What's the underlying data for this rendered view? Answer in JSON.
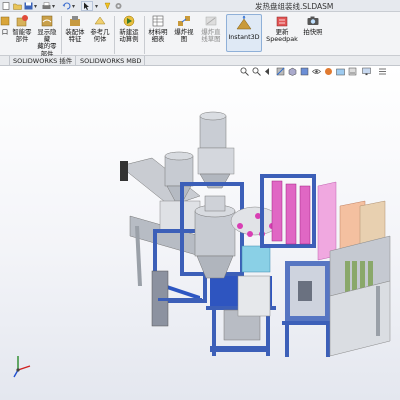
{
  "window": {
    "doc_title": "发热盘组装线.SLDASM"
  },
  "ribbon": {
    "buttons": [
      {
        "id": "edit-component",
        "label1": "口",
        "label2": ""
      },
      {
        "id": "smart-component",
        "label1": "智能零",
        "label2": "部件"
      },
      {
        "id": "show-hidden",
        "label1": "显示隐藏",
        "label2": "藏的零",
        "label3": "部件"
      },
      {
        "id": "assembly-feature",
        "label1": "装配体",
        "label2": "特征"
      },
      {
        "id": "reference-geometry",
        "label1": "参考几",
        "label2": "何体"
      },
      {
        "id": "new-motion",
        "label1": "新建运",
        "label2": "动算例"
      },
      {
        "id": "bom",
        "label1": "材料明",
        "label2": "细表"
      },
      {
        "id": "exploded-view",
        "label1": "爆炸视",
        "label2": "图"
      },
      {
        "id": "explode-line",
        "label1": "爆炸直",
        "label2": "线草图"
      },
      {
        "id": "instant3d",
        "label1": "Instant3D",
        "label2": ""
      },
      {
        "id": "speedpak",
        "label1": "更新",
        "label2": "Speedpak"
      },
      {
        "id": "snapshot",
        "label1": "拍快照",
        "label2": ""
      }
    ]
  },
  "tabs": [
    {
      "label": ""
    },
    {
      "label": "SOLIDWORKS 插件"
    },
    {
      "label": "SOLIDWORKS MBD"
    }
  ],
  "colors": {
    "accent_blue": "#3c5fb8",
    "magenta": "#d83fb4",
    "frame_gray": "#9aa0a8",
    "highlight": "#dfe9f5"
  }
}
